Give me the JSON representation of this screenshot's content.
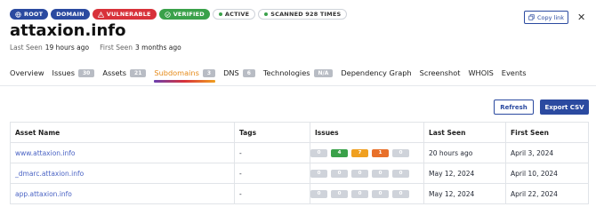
{
  "badges": {
    "root": "ROOT",
    "domain": "DOMAIN",
    "vulnerable": "VULNERABLE",
    "verified": "VERIFIED",
    "active": "ACTIVE",
    "scanned": "SCANNED 928 TIMES"
  },
  "header": {
    "copy_link": "Copy link",
    "title": "attaxion.info",
    "last_seen_label": "Last Seen",
    "last_seen_value": "19 hours ago",
    "first_seen_label": "First Seen",
    "first_seen_value": "3 months ago"
  },
  "tabs": [
    {
      "label": "Overview",
      "count": ""
    },
    {
      "label": "Issues",
      "count": "30"
    },
    {
      "label": "Assets",
      "count": "21"
    },
    {
      "label": "Subdomains",
      "count": "3"
    },
    {
      "label": "DNS",
      "count": "6"
    },
    {
      "label": "Technologies",
      "count": "N/A"
    },
    {
      "label": "Dependency Graph",
      "count": ""
    },
    {
      "label": "Screenshot",
      "count": ""
    },
    {
      "label": "WHOIS",
      "count": ""
    },
    {
      "label": "Events",
      "count": ""
    }
  ],
  "actions": {
    "refresh": "Refresh",
    "export": "Export CSV"
  },
  "table": {
    "columns": [
      "Asset Name",
      "Tags",
      "Issues",
      "Last Seen",
      "First Seen"
    ],
    "rows": [
      {
        "name": "www.attaxion.info",
        "tags": "-",
        "issues": [
          "0",
          "4",
          "7",
          "1",
          "0"
        ],
        "last_seen": "20 hours ago",
        "first_seen": "April 3, 2024"
      },
      {
        "name": "_dmarc.attaxion.info",
        "tags": "-",
        "issues": [
          "0",
          "0",
          "0",
          "0",
          "0"
        ],
        "last_seen": "May 12, 2024",
        "first_seen": "April 10, 2024"
      },
      {
        "name": "app.attaxion.info",
        "tags": "-",
        "issues": [
          "0",
          "0",
          "0",
          "0",
          "0"
        ],
        "last_seen": "May 12, 2024",
        "first_seen": "April 22, 2024"
      }
    ]
  },
  "colors": {
    "brand": "#2b4aa0",
    "issue_zero": "#cfd3da",
    "issue_high": "#3aa14a",
    "issue_medium": "#f0a020",
    "issue_low": "#e8702a"
  }
}
